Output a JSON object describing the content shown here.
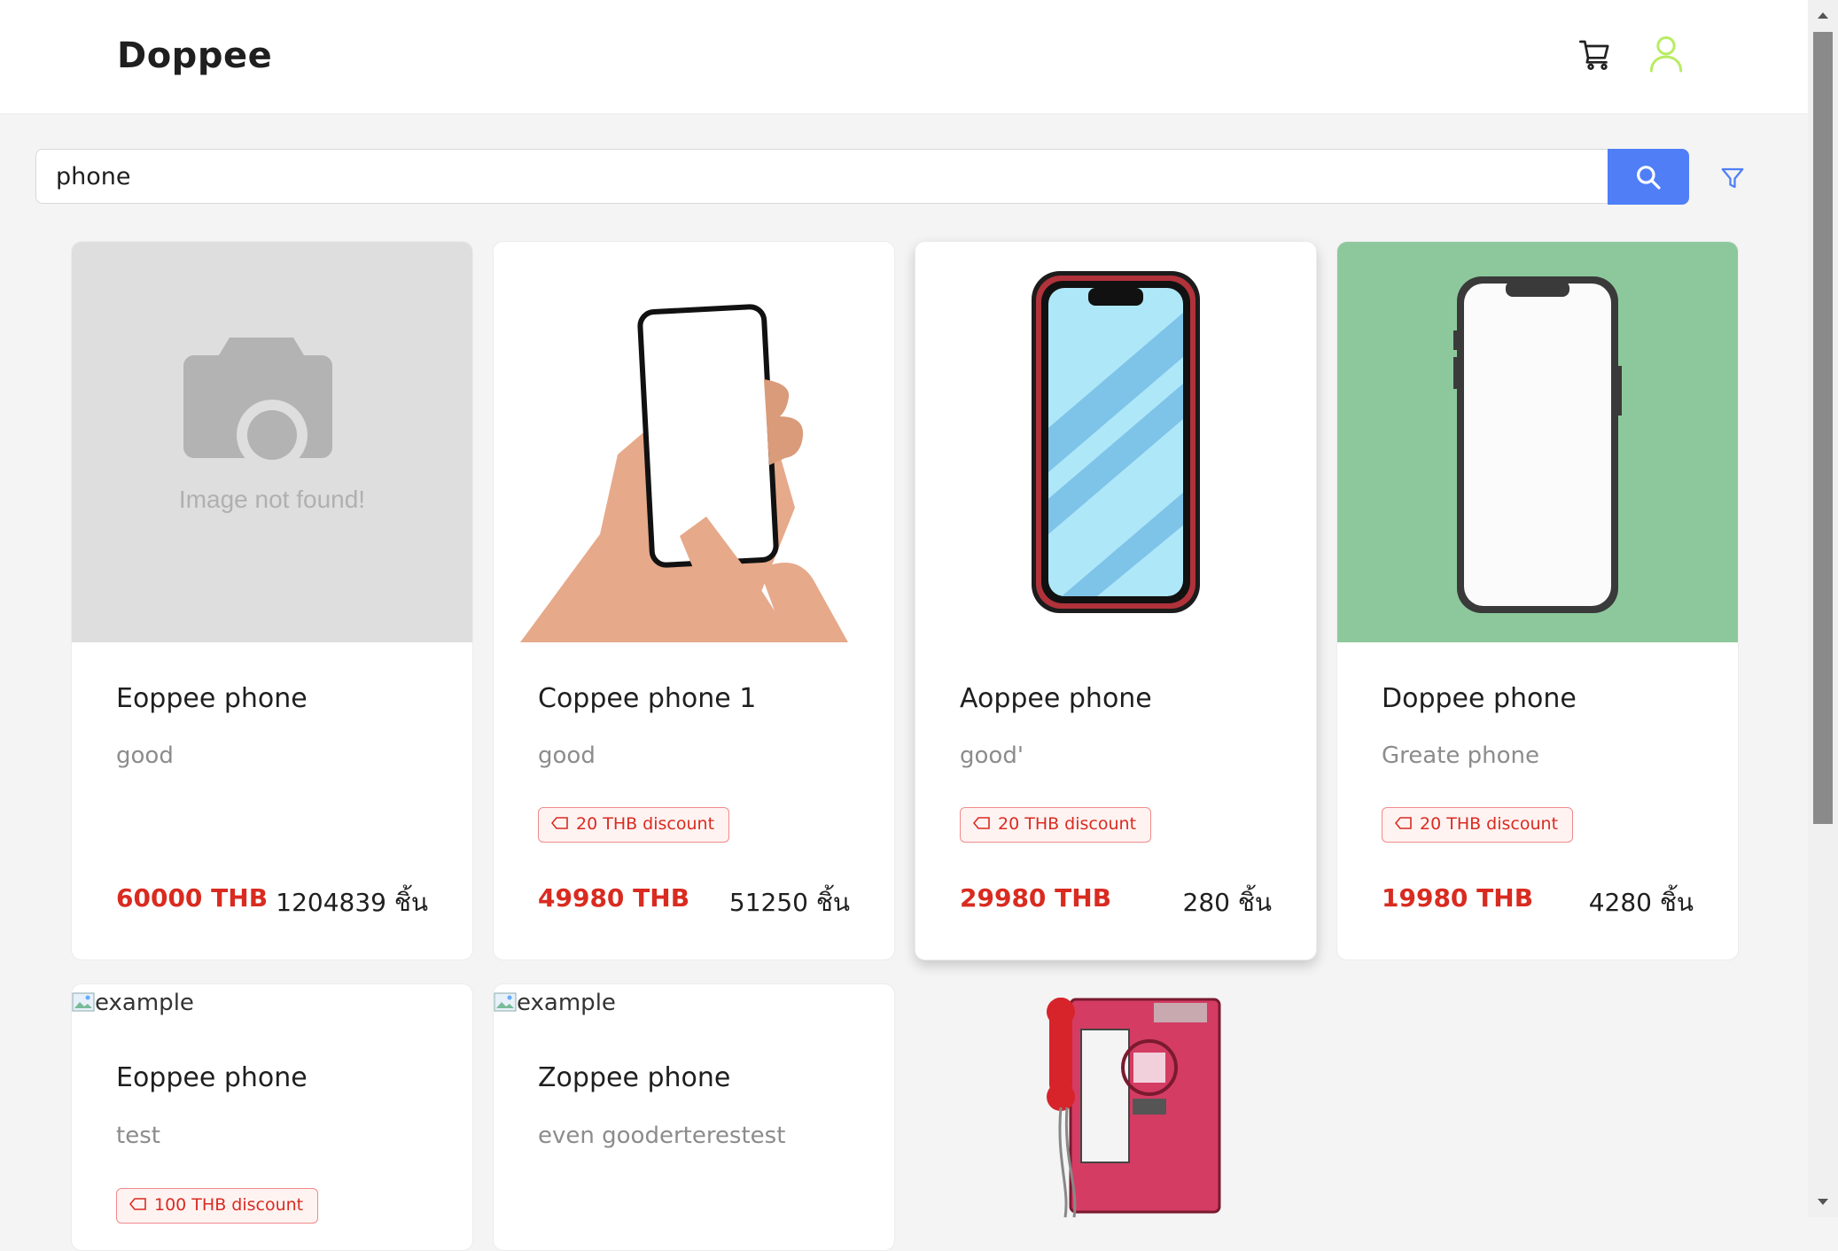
{
  "header": {
    "brand": "Doppee",
    "cart_icon": "shopping-cart-icon",
    "user_icon": "user-icon",
    "user_color": "#b9ec63"
  },
  "search": {
    "value": "phone",
    "button_icon": "search-icon",
    "filter_icon": "filter-icon",
    "accent": "#4f7ef6"
  },
  "products": [
    {
      "title": "Eoppee phone",
      "desc": "good",
      "discount": "",
      "price": "60000 THB",
      "stock": "1204839 ชิ้น",
      "image": "Image not found!"
    },
    {
      "title": "Coppee phone 1",
      "desc": "good",
      "discount": "20 THB discount",
      "price": "49980 THB",
      "stock": "51250 ชิ้น"
    },
    {
      "title": "Aoppee phone",
      "desc": "good'",
      "discount": "20 THB discount",
      "price": "29980 THB",
      "stock": "280 ชิ้น"
    },
    {
      "title": "Doppee phone",
      "desc": "Greate phone",
      "discount": "20 THB discount",
      "price": "19980 THB",
      "stock": "4280 ชิ้น"
    },
    {
      "title": "Eoppee phone",
      "desc": "test",
      "discount": "100 THB discount",
      "image_alt": "example"
    },
    {
      "title": "Zoppee phone",
      "desc": "even gooderterestest",
      "image_alt": "example"
    }
  ],
  "colors": {
    "price": "#d92b20",
    "discount_border": "#f08a8a",
    "discount_bg": "#fff3f2"
  }
}
